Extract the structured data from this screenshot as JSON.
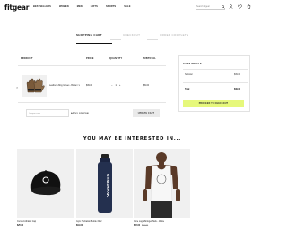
{
  "header": {
    "logo": "fitgear",
    "nav": [
      "BESTSELLERS",
      "WOMEN",
      "MEN",
      "GIFTS",
      "SPORTS",
      "SALE"
    ],
    "search_placeholder": "Search fitgear"
  },
  "steps": {
    "shopping_cart": "SHOPPING CART",
    "checkout": "CHECKOUT",
    "order_complete": "ORDER COMPLETE"
  },
  "cart": {
    "headers": {
      "product": "PRODUCT",
      "price": "PRICE",
      "quantity": "QUANTITY",
      "subtotal": "SUBTOTAL"
    },
    "items": [
      {
        "remove": "×",
        "name": "Leather Lifting Gloves - Brown / L",
        "price": "$39.00",
        "qty_minus": "–",
        "qty": "1",
        "qty_plus": "+",
        "subtotal": "$39.00"
      }
    ],
    "coupon_placeholder": "Coupon code",
    "apply_label": "APPLY COUPON",
    "update_label": "UPDATE CART"
  },
  "totals": {
    "title": "CART TOTALS",
    "subtotal_label": "Subtotal",
    "subtotal_value": "$39.00",
    "total_label": "Total",
    "total_value": "$39.00",
    "checkout_label": "PROCEED TO CHECKOUT"
  },
  "interested": {
    "title": "YOU MAY BE INTERESTED IN...",
    "products": [
      {
        "name": "Curved Athletic Cap",
        "price": "$25.00",
        "old_price": "",
        "icon": "cap-image"
      },
      {
        "name": "Gym Hydration Bottle 32oz",
        "price": "$19.00",
        "old_price": "",
        "icon": "bottle-image",
        "bottle_text": "GYMSHARK"
      },
      {
        "name": "Core Logo Stringer Tank - White",
        "price": "$22.00",
        "old_price": "$30.00",
        "icon": "tank-model-image"
      }
    ]
  },
  "colors": {
    "accent": "#e6f87b",
    "thumb_bg": "#f0f0f0"
  }
}
